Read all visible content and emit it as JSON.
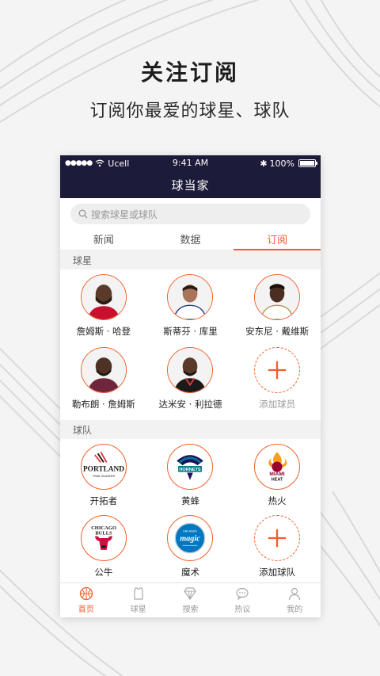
{
  "promo": {
    "title": "关注订阅",
    "subtitle": "订阅你最爱的球星、球队"
  },
  "status_bar": {
    "carrier": "Ucell",
    "time": "9:41 AM",
    "battery": "100%"
  },
  "app": {
    "title": "球当家"
  },
  "search": {
    "placeholder": "搜索球星或球队"
  },
  "tabs": [
    {
      "label": "新闻",
      "active": false
    },
    {
      "label": "数据",
      "active": false
    },
    {
      "label": "订阅",
      "active": true
    }
  ],
  "players_section": {
    "header": "球星",
    "items": [
      {
        "name": "詹姆斯 · 哈登",
        "jersey_color": "#c8102e"
      },
      {
        "name": "斯蒂芬 · 库里",
        "jersey_color": "#ffffff"
      },
      {
        "name": "安东尼 · 戴维斯",
        "jersey_color": "#ffffff"
      },
      {
        "name": "勒布朗 · 詹姆斯",
        "jersey_color": "#6f263d"
      },
      {
        "name": "达米安 · 利拉德",
        "jersey_color": "#1a1a1a"
      }
    ],
    "add_label": "添加球员"
  },
  "teams_section": {
    "header": "球队",
    "items": [
      {
        "name": "开拓者",
        "logo_icon": "trail-blazers-logo",
        "logo_text": "PORTLAND",
        "logo_subtext": "TRAIL BLAZERS"
      },
      {
        "name": "黄蜂",
        "logo_icon": "hornets-logo",
        "logo_text": "HORNETS",
        "logo_subtext": ""
      },
      {
        "name": "热火",
        "logo_icon": "heat-logo",
        "logo_text": "MIAMI",
        "logo_subtext": "HEAT"
      },
      {
        "name": "公牛",
        "logo_icon": "bulls-logo",
        "logo_text": "CHICAGO",
        "logo_subtext": "BULLS"
      },
      {
        "name": "魔术",
        "logo_icon": "magic-logo",
        "logo_text": "magic",
        "logo_subtext": "ORLANDO"
      }
    ],
    "add_label": "添加球队"
  },
  "bottom_nav": [
    {
      "label": "首页",
      "icon": "basketball-icon",
      "active": true
    },
    {
      "label": "球星",
      "icon": "jersey-icon",
      "active": false
    },
    {
      "label": "搜索",
      "icon": "diamond-icon",
      "active": false
    },
    {
      "label": "热议",
      "icon": "chat-icon",
      "active": false
    },
    {
      "label": "我的",
      "icon": "user-icon",
      "active": false
    }
  ],
  "colors": {
    "accent": "#f1602b",
    "header_bg": "#1c1b3a"
  }
}
